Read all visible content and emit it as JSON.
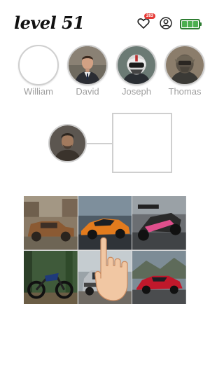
{
  "header": {
    "level_label": "level 51",
    "hearts_count": "263",
    "icons": [
      "heart-icon",
      "profile-icon",
      "battery-icon"
    ],
    "battery_level": 1.0
  },
  "players": [
    {
      "name": "William",
      "avatar": "empty"
    },
    {
      "name": "David",
      "avatar": "man-in-suit"
    },
    {
      "name": "Joseph",
      "avatar": "racing-helmet"
    },
    {
      "name": "Thomas",
      "avatar": "motocross-rider"
    }
  ],
  "question": {
    "avatar": "rugged-old-man",
    "answer_slot": "empty"
  },
  "grid": {
    "tiles": [
      {
        "label": "rusty-old-car"
      },
      {
        "label": "orange-supercar"
      },
      {
        "label": "formula-race-car"
      },
      {
        "label": "dirt-bike"
      },
      {
        "label": "silver-pickup-truck"
      },
      {
        "label": "red-sports-car"
      }
    ]
  },
  "colors": {
    "accent_green": "#4caf50",
    "badge_red": "#e53935",
    "name_gray": "#9e9e9e",
    "border_gray": "#cfcfcf"
  }
}
